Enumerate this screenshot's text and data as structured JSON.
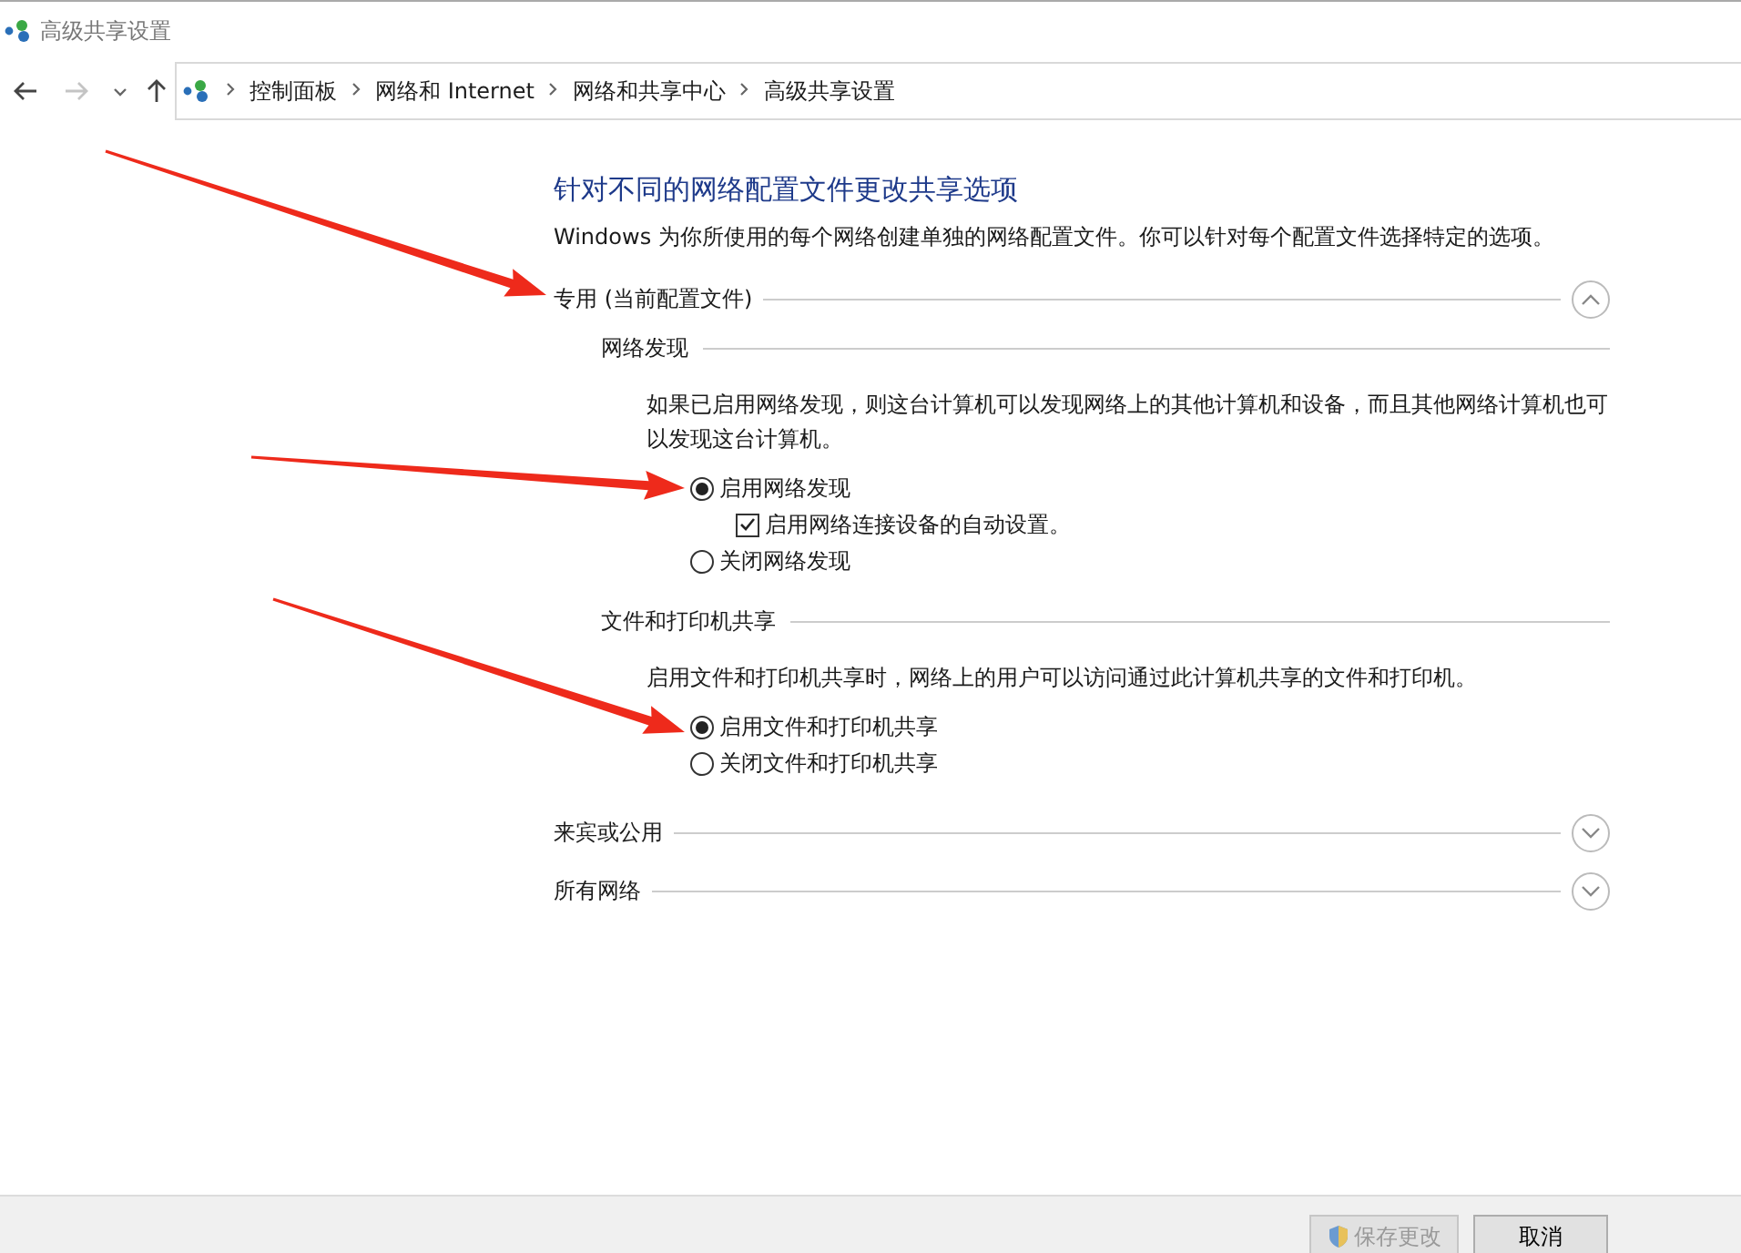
{
  "window": {
    "title": "高级共享设置"
  },
  "navigation": {
    "back": {
      "disabled": false
    },
    "forward": {
      "disabled": true
    }
  },
  "breadcrumb": [
    "控制面板",
    "网络和 Internet",
    "网络和共享中心",
    "高级共享设置"
  ],
  "heading": "针对不同的网络配置文件更改共享选项",
  "description": "Windows 为你所使用的每个网络创建单独的网络配置文件。你可以针对每个配置文件选择特定的选项。",
  "sections": [
    {
      "title": "专用 (当前配置文件)",
      "expanded": true,
      "subsections": [
        {
          "title": "网络发现",
          "description": "如果已启用网络发现，则这台计算机可以发现网络上的其他计算机和设备，而且其他网络计算机也可以发现这台计算机。",
          "options": [
            {
              "label": "启用网络发现",
              "selected": true,
              "sub_option": {
                "label": "启用网络连接设备的自动设置。",
                "checked": true
              }
            },
            {
              "label": "关闭网络发现",
              "selected": false
            }
          ]
        },
        {
          "title": "文件和打印机共享",
          "description": "启用文件和打印机共享时，网络上的用户可以访问通过此计算机共享的文件和打印机。",
          "options": [
            {
              "label": "启用文件和打印机共享",
              "selected": true
            },
            {
              "label": "关闭文件和打印机共享",
              "selected": false
            }
          ]
        }
      ]
    },
    {
      "title": "来宾或公用",
      "expanded": false
    },
    {
      "title": "所有网络",
      "expanded": false
    }
  ],
  "buttons": [
    {
      "label": "保存更改",
      "kind": "shield",
      "disabled": true
    },
    {
      "label": "取消",
      "kind": "plain",
      "disabled": false
    }
  ]
}
